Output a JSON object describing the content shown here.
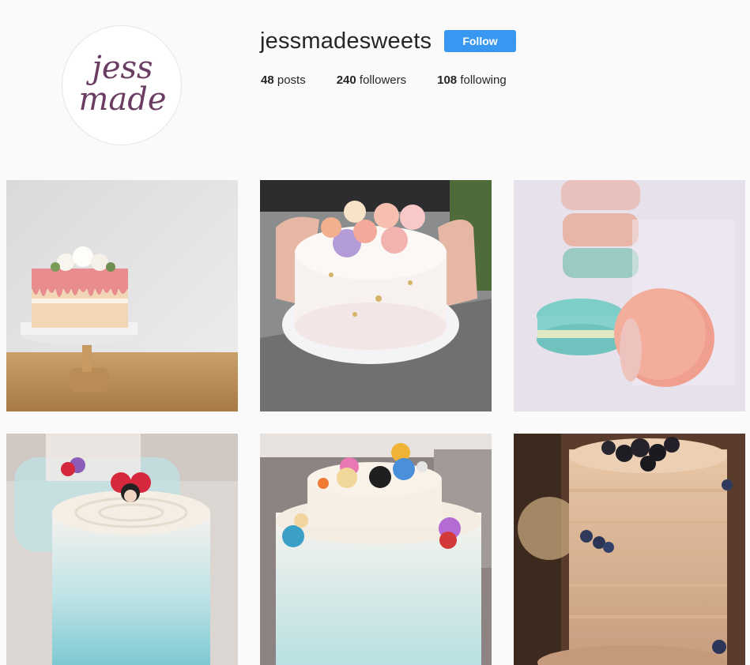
{
  "profile": {
    "avatar_text_line1": "jess",
    "avatar_text_line2": "made",
    "username": "jessmadesweets",
    "follow_label": "Follow",
    "stats": [
      {
        "count": "48",
        "label": "posts"
      },
      {
        "count": "240",
        "label": "followers"
      },
      {
        "count": "108",
        "label": "following"
      }
    ]
  },
  "posts": [
    {
      "subject": "naked drip cake with white roses on wooden stand"
    },
    {
      "subject": "hands holding white cake with paper roses and gold flakes"
    },
    {
      "subject": "pastel macarons in clear box"
    },
    {
      "subject": "blue ombre cake with minnie mouse topper"
    },
    {
      "subject": "two tier cake with tsum tsum figures"
    },
    {
      "subject": "textured buttercream cake with blackberries"
    }
  ],
  "colors": {
    "accent": "#3897f0",
    "avatar_text": "#6b3d63",
    "background": "#fafafa"
  }
}
